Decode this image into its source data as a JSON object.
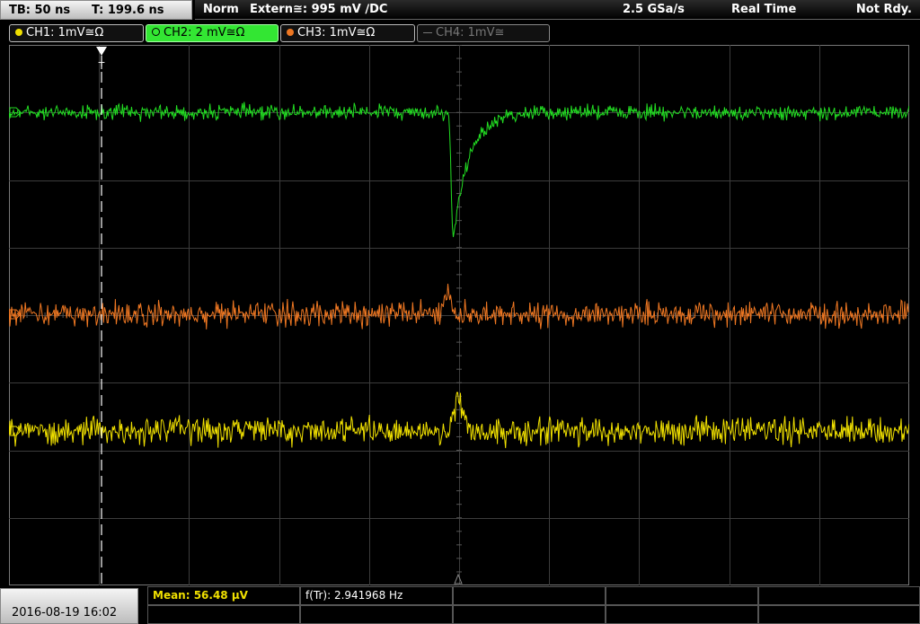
{
  "status_bar": {
    "timebase": "TB: 50 ns",
    "trigger_time": "T: 199.6 ns",
    "trigger_mode": "Norm",
    "trigger_source": "Extern≅: 995 mV",
    "trigger_slope_coupling": "∕DC",
    "sample_rate": "2.5 GSa/s",
    "acq_mode": "Real Time",
    "acq_state": "Not Rdy."
  },
  "channels": [
    {
      "label": "CH1: 1mV≅Ω",
      "color": "#f0e000",
      "active": true
    },
    {
      "label": "CH2: 2 mV≅Ω",
      "color": "#22dd22",
      "active": true
    },
    {
      "label": "CH3: 1mV≅Ω",
      "color": "#ee7722",
      "active": true
    },
    {
      "label": "CH4: 1mV≅",
      "color": "#666666",
      "active": false
    }
  ],
  "trigger_marker": "T",
  "measurements": {
    "mean": "Mean: 56.48 µV",
    "freq": "f(Tr): 2.941968 Hz"
  },
  "datetime": "2016-08-19 16:02",
  "colors": {
    "ch1": "#f0e000",
    "ch2": "#22dd22",
    "ch3": "#ee7722",
    "grid": "#3c3c3c"
  }
}
